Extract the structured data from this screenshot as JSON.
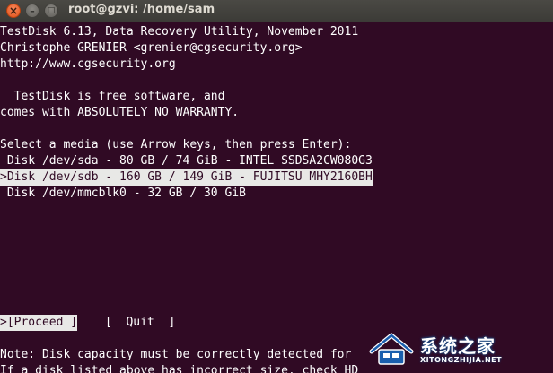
{
  "window": {
    "title": "root@gzvi: /home/sam",
    "close_glyph": "×",
    "minimize_glyph": "–",
    "maximize_glyph": "□"
  },
  "terminal": {
    "header": [
      "TestDisk 6.13, Data Recovery Utility, November 2011",
      "Christophe GRENIER <grenier@cgsecurity.org>",
      "http://www.cgsecurity.org"
    ],
    "license": [
      "  TestDisk is free software, and",
      "comes with ABSOLUTELY NO WARRANTY."
    ],
    "prompt": "Select a media (use Arrow keys, then press Enter):",
    "disks": [
      " Disk /dev/sda - 80 GB / 74 GiB - INTEL SSDSA2CW080G3",
      ">Disk /dev/sdb - 160 GB / 149 GiB - FUJITSU MHY2160BH",
      " Disk /dev/mmcblk0 - 32 GB / 30 GiB"
    ],
    "selected_disk_index": 1,
    "actions": {
      "proceed": ">[Proceed ]",
      "quit": "[  Quit  ]"
    },
    "notes": [
      "Note: Disk capacity must be correctly detected for",
      "If a disk listed above has incorrect size, check HD"
    ]
  },
  "watermark": {
    "brand": "系统之家",
    "url": "XITONGZHIJIA.NET"
  },
  "colors": {
    "terminal_bg": "#300a24",
    "terminal_fg": "#ffffff",
    "highlight_bg": "#e8e8e6",
    "close_button": "#e1521a"
  }
}
